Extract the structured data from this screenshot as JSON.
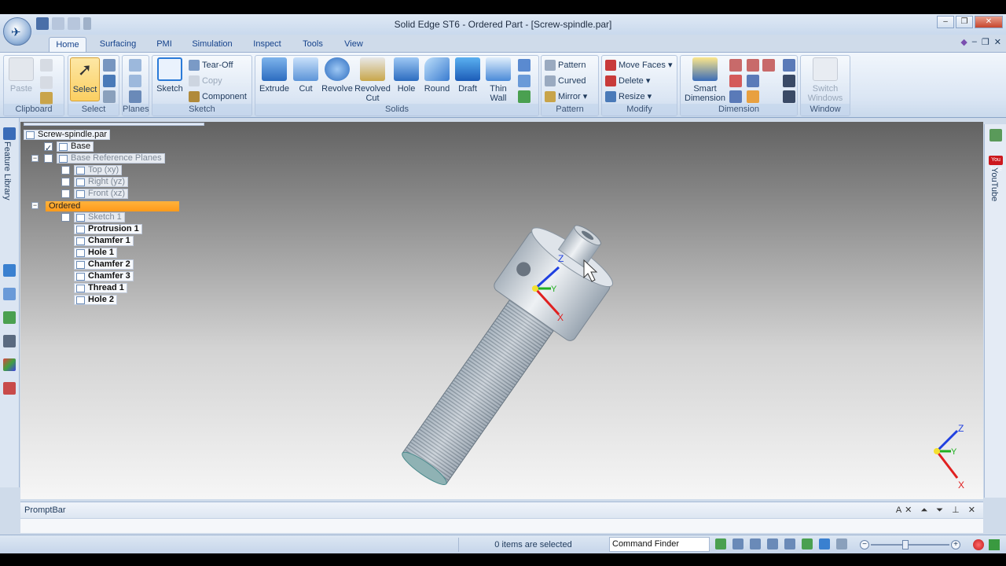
{
  "window": {
    "title": "Solid Edge ST6 - Ordered Part - [Screw-spindle.par]"
  },
  "tabs": [
    "Home",
    "Surfacing",
    "PMI",
    "Simulation",
    "Inspect",
    "Tools",
    "View"
  ],
  "ribbon": {
    "clipboard": {
      "title": "Clipboard",
      "paste": "Paste"
    },
    "select": {
      "title": "Select",
      "select": "Select"
    },
    "planes": {
      "title": "Planes"
    },
    "sketch": {
      "title": "Sketch",
      "sketch": "Sketch",
      "tear_off": "Tear-Off",
      "copy": "Copy",
      "component": "Component"
    },
    "solids": {
      "title": "Solids",
      "extrude": "Extrude",
      "cut": "Cut",
      "revolve": "Revolve",
      "revolved_cut_1": "Revolved",
      "revolved_cut_2": "Cut",
      "hole": "Hole",
      "round": "Round",
      "draft": "Draft",
      "thin_wall_1": "Thin",
      "thin_wall_2": "Wall"
    },
    "pattern": {
      "title": "Pattern",
      "pattern": "Pattern",
      "curved": "Curved",
      "mirror": "Mirror"
    },
    "modify": {
      "title": "Modify",
      "move_faces": "Move Faces",
      "delete": "Delete",
      "resize": "Resize"
    },
    "dimension": {
      "title": "Dimension",
      "smart_1": "Smart",
      "smart_2": "Dimension"
    },
    "window": {
      "title": "Window",
      "switch_1": "Switch",
      "switch_2": "Windows"
    }
  },
  "left_panel": {
    "label": "Feature Library"
  },
  "right_panel": {
    "youtube_badge": "You Tube",
    "label": "YouTube"
  },
  "tree": {
    "root": "Screw-spindle.par",
    "base": "Base",
    "base_ref_planes": "Base Reference Planes",
    "top": "Top (xy)",
    "right": "Right (yz)",
    "front": "Front (xz)",
    "ordered": "Ordered",
    "features": [
      "Sketch 1",
      "Protrusion 1",
      "Chamfer 1",
      "Hole 1",
      "Chamfer 2",
      "Chamfer 3",
      "Thread 1",
      "Hole 2"
    ]
  },
  "axes": {
    "x": "X",
    "y": "Y",
    "z": "Z"
  },
  "promptbar": {
    "title": "PromptBar"
  },
  "statusbar": {
    "status": "0 items are selected",
    "command_finder": "Command Finder"
  },
  "colors": {
    "ordered_highlight": "#ff9a1a",
    "select_highlight": "#fbcf61",
    "axis_x": "#e02020",
    "axis_y": "#20b020",
    "axis_z": "#2040e0"
  }
}
